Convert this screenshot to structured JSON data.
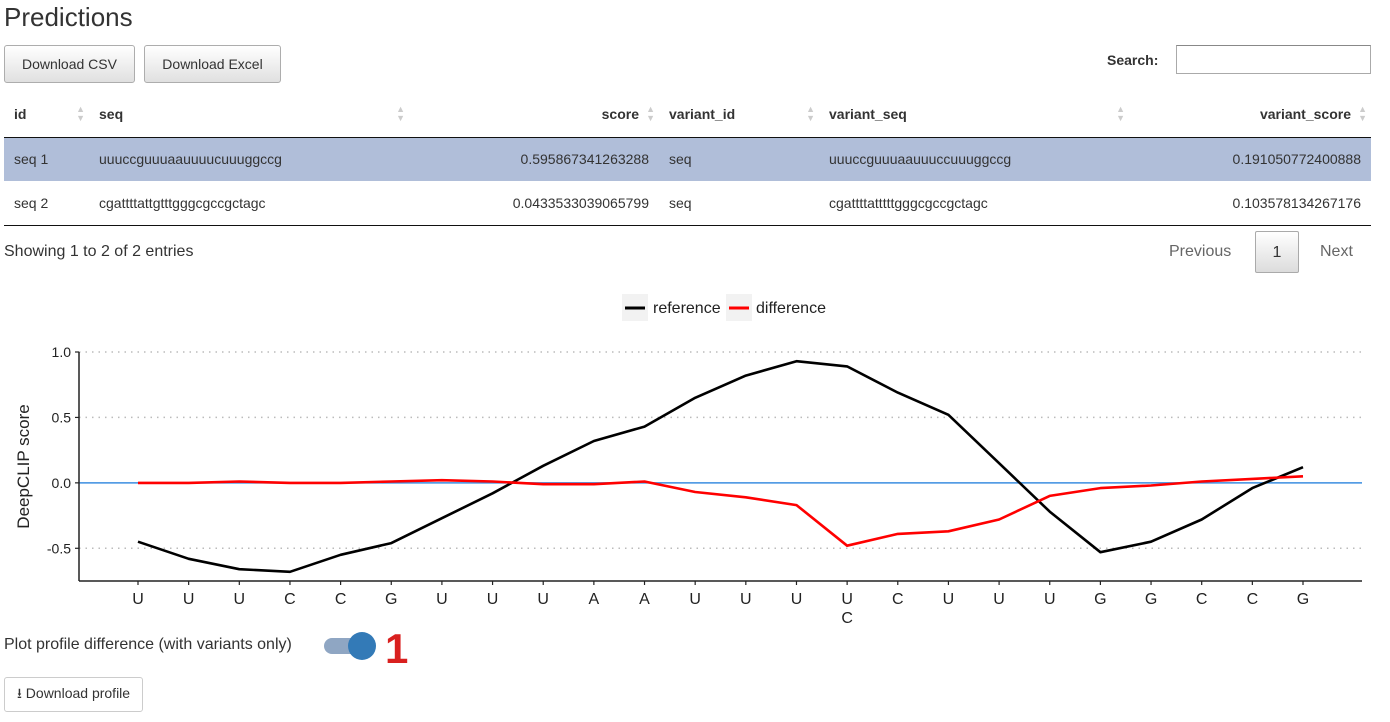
{
  "page_title": "Predictions",
  "toolbar": {
    "csv_label": "Download CSV",
    "excel_label": "Download Excel"
  },
  "search": {
    "label": "Search:",
    "value": "",
    "placeholder": ""
  },
  "table": {
    "columns": [
      "id",
      "seq",
      "score",
      "variant_id",
      "variant_seq",
      "variant_score"
    ],
    "rows": [
      {
        "id": "seq 1",
        "seq": "uuuccguuuaauuuucuuuggccg",
        "score": "0.595867341263288",
        "variant_id": "seq",
        "variant_seq": "uuuccguuuaauuuccuuuggccg",
        "variant_score": "0.191050772400888",
        "selected": true
      },
      {
        "id": "seq 2",
        "seq": "cgattttattgtttgggcgccgctagc",
        "score": "0.0433533039065799",
        "variant_id": "seq",
        "variant_seq": "cgattttatttttgggcgccgctagc",
        "variant_score": "0.103578134267176",
        "selected": false
      }
    ]
  },
  "pagination": {
    "info": "Showing 1 to 2 of 2 entries",
    "previous": "Previous",
    "current": "1",
    "next": "Next"
  },
  "chart_data": {
    "type": "line",
    "title": "",
    "xlabel": "",
    "ylabel": "DeepCLIP score",
    "ylim": [
      -0.75,
      1.0
    ],
    "yticks": [
      -0.5,
      0.0,
      0.5,
      1.0
    ],
    "ytick_labels": [
      "-0.5",
      "0.0",
      "0.5",
      "1.0"
    ],
    "grid": "horizontal dotted",
    "legend_position": "top-center",
    "categories": [
      "U",
      "U",
      "U",
      "C",
      "C",
      "G",
      "U",
      "U",
      "U",
      "A",
      "A",
      "U",
      "U",
      "U",
      "U",
      "C",
      "U",
      "U",
      "U",
      "G",
      "G",
      "C",
      "C",
      "G"
    ],
    "variant_labels": {
      "14": "C"
    },
    "zero_line_color": "#3b8ee0",
    "series": [
      {
        "name": "reference",
        "color": "#000000",
        "values": [
          -0.45,
          -0.58,
          -0.66,
          -0.68,
          -0.55,
          -0.46,
          -0.27,
          -0.08,
          0.13,
          0.32,
          0.43,
          0.65,
          0.82,
          0.93,
          0.89,
          0.69,
          0.52,
          0.15,
          -0.22,
          -0.53,
          -0.45,
          -0.28,
          -0.04,
          0.12
        ]
      },
      {
        "name": "difference",
        "color": "#ff0000",
        "values": [
          0.0,
          0.0,
          0.01,
          0.0,
          0.0,
          0.01,
          0.02,
          0.01,
          -0.01,
          -0.01,
          0.01,
          -0.07,
          -0.11,
          -0.17,
          -0.48,
          -0.39,
          -0.37,
          -0.28,
          -0.1,
          -0.04,
          -0.02,
          0.01,
          0.03,
          0.05
        ]
      }
    ]
  },
  "controls": {
    "toggle_label": "Plot profile difference (with variants only)",
    "toggle_on": true,
    "annotation": "1",
    "download_profile_label": "Download profile"
  }
}
